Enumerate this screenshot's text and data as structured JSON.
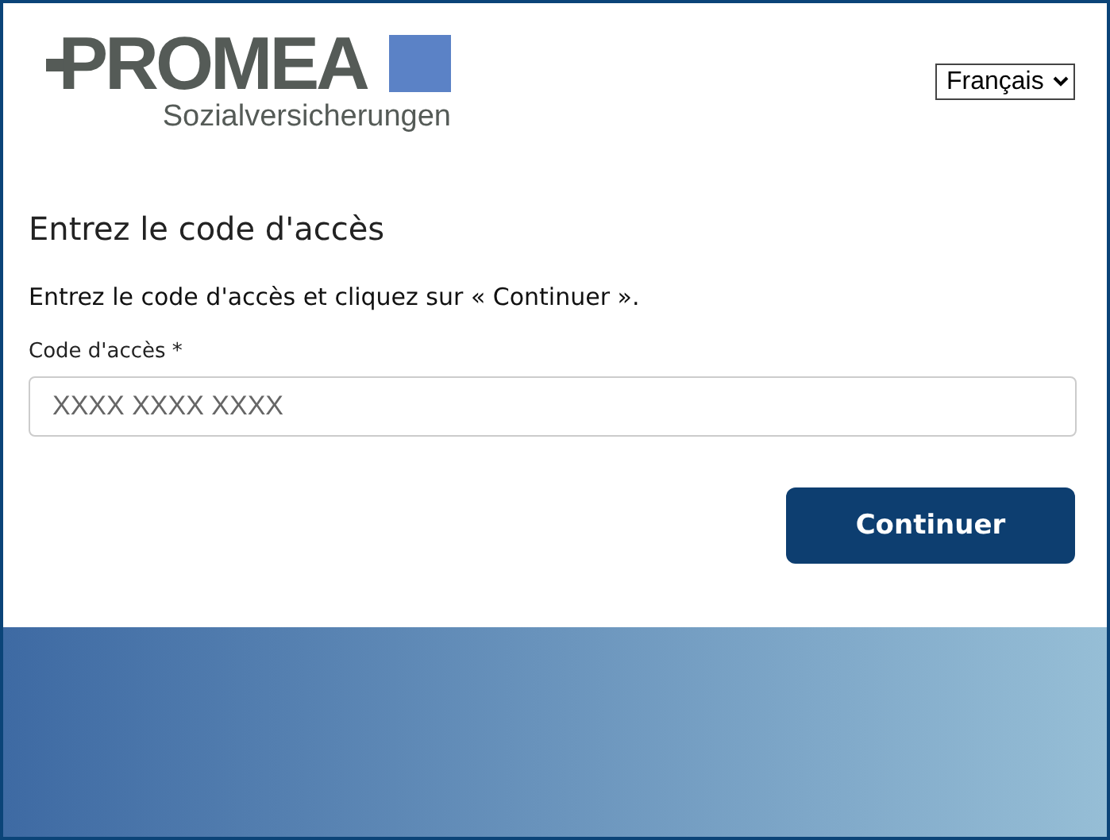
{
  "logo": {
    "name": "PROMEA",
    "tagline": "Sozialversicherungen"
  },
  "language": {
    "value": "Français"
  },
  "heading": "Entrez le code d'accès",
  "instruction": "Entrez le code d'accès et cliquez sur « Continuer ».",
  "field": {
    "label": "Code d'accès *",
    "placeholder": "XXXX XXXX XXXX"
  },
  "buttons": [
    "Continuer"
  ]
}
